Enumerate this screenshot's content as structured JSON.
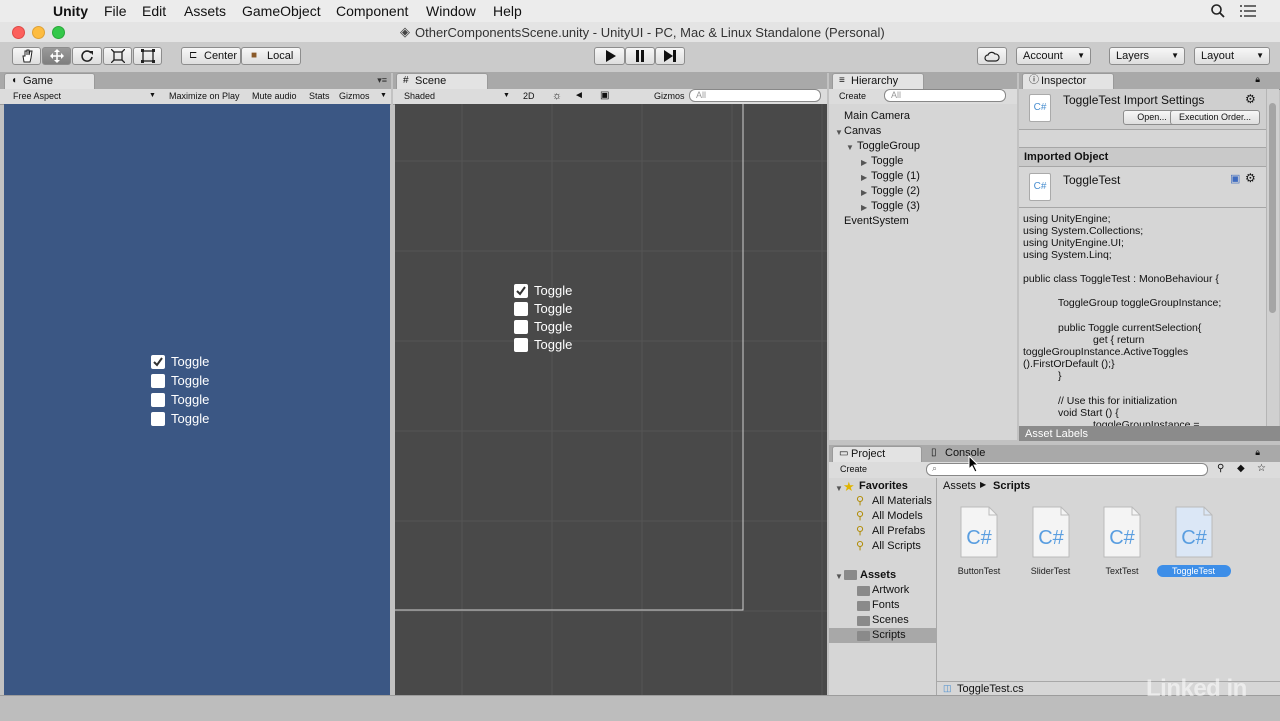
{
  "menubar": {
    "app": "Unity",
    "items": [
      "File",
      "Edit",
      "Assets",
      "GameObject",
      "Component",
      "Window",
      "Help"
    ]
  },
  "window_title": "OtherComponentsScene.unity - UnityUI - PC, Mac & Linux Standalone (Personal)",
  "toolbar": {
    "center_label": "Center",
    "local_label": "Local",
    "account_label": "Account",
    "layers_label": "Layers",
    "layout_label": "Layout"
  },
  "game": {
    "tab": "Game",
    "aspect": "Free Aspect",
    "maximize": "Maximize on Play",
    "mute": "Mute audio",
    "stats": "Stats",
    "gizmos": "Gizmos",
    "toggles": [
      {
        "label": "Toggle",
        "checked": true
      },
      {
        "label": "Toggle",
        "checked": false
      },
      {
        "label": "Toggle",
        "checked": false
      },
      {
        "label": "Toggle",
        "checked": false
      }
    ]
  },
  "scene": {
    "tab": "Scene",
    "shading": "Shaded",
    "mode2d": "2D",
    "gizmos": "Gizmos",
    "search_placeholder": "All",
    "toggles": [
      {
        "label": "Toggle",
        "checked": true
      },
      {
        "label": "Toggle",
        "checked": false
      },
      {
        "label": "Toggle",
        "checked": false
      },
      {
        "label": "Toggle",
        "checked": false
      }
    ]
  },
  "hierarchy": {
    "tab": "Hierarchy",
    "create": "Create",
    "search_placeholder": "All",
    "items": [
      "Main Camera",
      "Canvas",
      "ToggleGroup",
      "Toggle",
      "Toggle (1)",
      "Toggle (2)",
      "Toggle (3)",
      "EventSystem"
    ]
  },
  "inspector": {
    "tab": "Inspector",
    "title": "ToggleTest Import Settings",
    "open_button": "Open...",
    "exec_button": "Execution Order...",
    "imported_header": "Imported Object",
    "imported_name": "ToggleTest",
    "asset_labels": "Asset Labels",
    "code_lines": [
      "using UnityEngine;",
      "using System.Collections;",
      "using UnityEngine.UI;",
      "using System.Linq;",
      "",
      "public class ToggleTest : MonoBehaviour {",
      "",
      "            ToggleGroup toggleGroupInstance;",
      "",
      "            public Toggle currentSelection{",
      "                        get { return",
      "toggleGroupInstance.ActiveToggles",
      "().FirstOrDefault ();}",
      "            }",
      "",
      "            // Use this for initialization",
      "            void Start () {",
      "                        toggleGroupInstance ="
    ]
  },
  "project": {
    "tab": "Project",
    "console_tab": "Console",
    "create": "Create",
    "favorites_label": "Favorites",
    "favorites": [
      "All Materials",
      "All Models",
      "All Prefabs",
      "All Scripts"
    ],
    "assets_label": "Assets",
    "folders": [
      "Artwork",
      "Fonts",
      "Scenes",
      "Scripts"
    ],
    "breadcrumb": [
      "Assets",
      "Scripts"
    ],
    "files": [
      "ButtonTest",
      "SliderTest",
      "TextTest",
      "ToggleTest"
    ],
    "selected_file": "ToggleTest",
    "footer_file": "ToggleTest.cs"
  },
  "watermark": "Linked in",
  "colors": {
    "game_bg": "#3b5784",
    "scene_bg": "#494949",
    "selection": "#3d8ee8"
  }
}
